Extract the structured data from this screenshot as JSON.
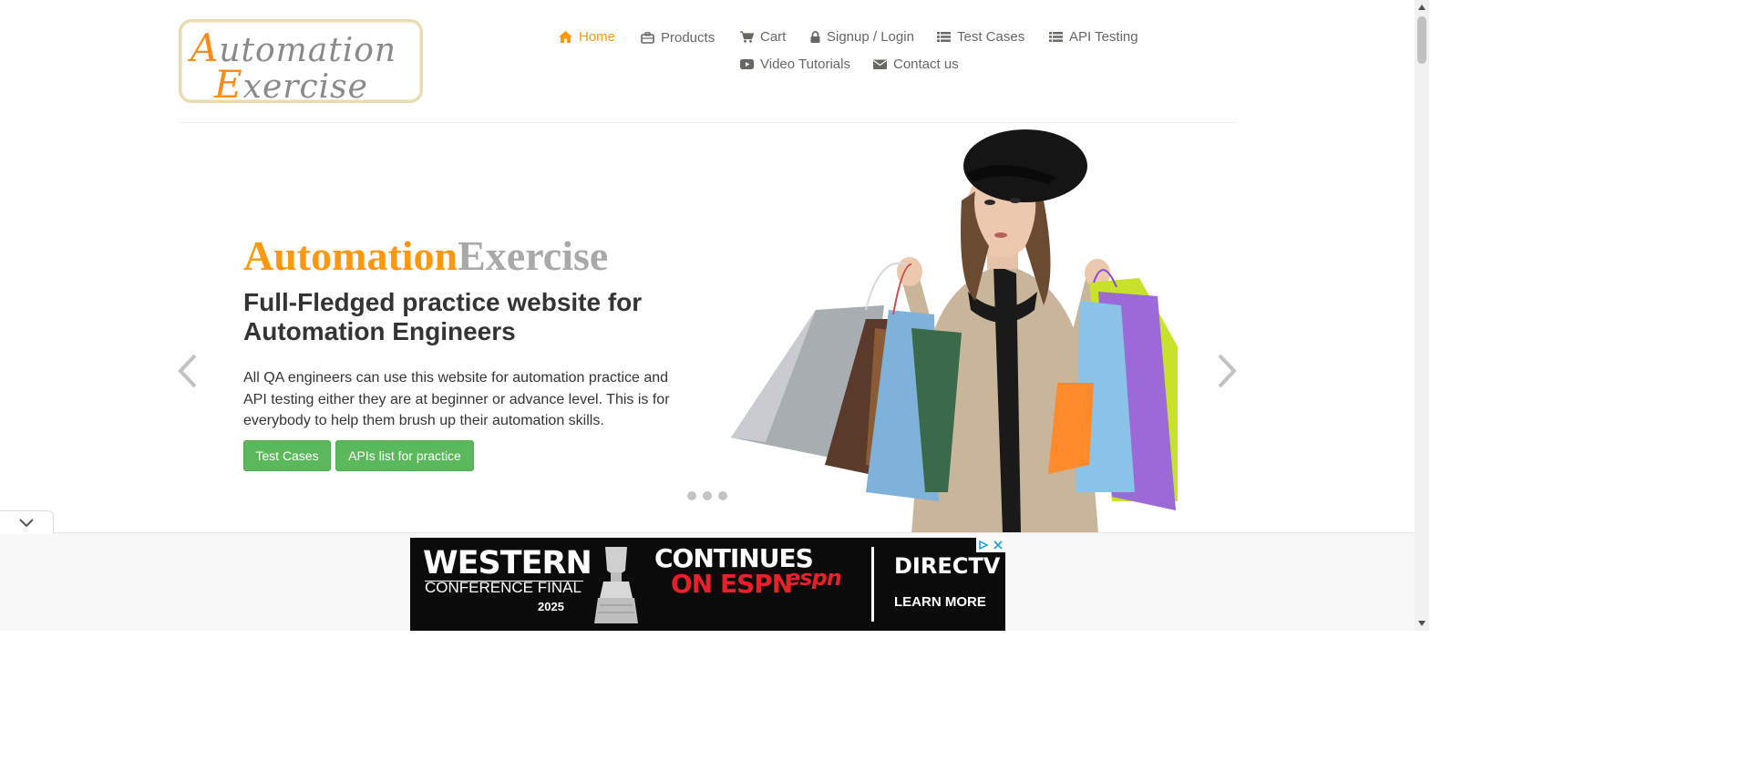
{
  "logo": {
    "line1_cap": "A",
    "line1_rest": "utomation",
    "line2_cap": "E",
    "line2_rest": "xercise"
  },
  "nav": [
    {
      "label": "Home",
      "icon": "home-icon",
      "active": true
    },
    {
      "label": "Products",
      "icon": "briefcase-icon"
    },
    {
      "label": "Cart",
      "icon": "cart-icon"
    },
    {
      "label": "Signup / Login",
      "icon": "lock-icon"
    },
    {
      "label": "Test Cases",
      "icon": "list-icon"
    },
    {
      "label": "API Testing",
      "icon": "list-icon"
    },
    {
      "label": "Video Tutorials",
      "icon": "youtube-icon"
    },
    {
      "label": "Contact us",
      "icon": "envelope-icon"
    }
  ],
  "hero": {
    "title_part1": "Automation",
    "title_part2": "Exercise",
    "subtitle": "Full-Fledged practice website for Automation Engineers",
    "description": "All QA engineers can use this website for automation practice and API testing either they are at beginner or advance level. This is for everybody to help them brush up their automation skills.",
    "button1": "Test Cases",
    "button2": "APIs list for practice",
    "slides": 3
  },
  "ad": {
    "line1": "WESTERN",
    "line2": "CONFERENCE FINAL",
    "year": "2025",
    "continues": "CONTINUES",
    "on_espn": "ON ESPN",
    "espn_logo": "ESPN",
    "brand": "DIRECTV",
    "cta": "LEARN MORE"
  },
  "colors": {
    "accent": "#FE980F",
    "button_green": "#5cb85c",
    "text_dark": "#363432",
    "nav_text": "#696763"
  }
}
